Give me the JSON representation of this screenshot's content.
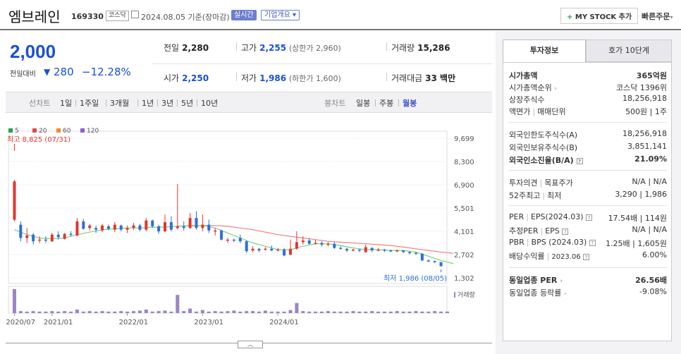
{
  "header": {
    "name": "엠브레인",
    "code": "169330",
    "market": "코스닥",
    "date": "2024.08.05 기준(장마감)",
    "realtime": "실시간",
    "overview": "기업개요",
    "mystock": "MY STOCK 추가",
    "quick_order": "빠른주문"
  },
  "price": {
    "current": "2,000",
    "change_label": "전일대비",
    "change_arrow": "▼",
    "change": "280",
    "change_pct": "−12.28%"
  },
  "quote": {
    "prev_label": "전일",
    "prev": "2,280",
    "high_label": "고가",
    "high": "2,255",
    "high_sub": "(상한가 2,960)",
    "volume_label": "거래량",
    "volume": "15,286",
    "open_label": "시가",
    "open": "2,250",
    "low_label": "저가",
    "low": "1,986",
    "low_sub": "(하한가 1,600)",
    "amount_label": "거래대금",
    "amount": "33 백만"
  },
  "tabs": {
    "line_label": "선차트",
    "periods": [
      "1일",
      "1주일",
      "3개월",
      "1년",
      "3년",
      "5년",
      "10년"
    ],
    "candle_label": "봉차트",
    "candles": [
      "일봉",
      "주봉",
      "월봉"
    ],
    "selected_candle": "월봉"
  },
  "chart_data": {
    "type": "candlestick",
    "legend": [
      "5",
      "20",
      "60",
      "120"
    ],
    "legend_colors": [
      "#2e9e4a",
      "#e5484d",
      "#f08c2e",
      "#8a62c8"
    ],
    "y_ticks": [
      "9,699",
      "8,300",
      "6,900",
      "5,501",
      "4,101",
      "2,702",
      "1,302"
    ],
    "ylim": [
      1302,
      9699
    ],
    "x_ticks": [
      "2020/07",
      "2021/01",
      "2022/01",
      "2023/01",
      "2024/01"
    ],
    "high_annotation": "최고 8,825 (07/31)",
    "low_annotation": "최저 1,986 (08/05)",
    "volume_label": "거래량",
    "candles": [
      {
        "o": 4800,
        "c": 7100,
        "h": 7200,
        "l": 4700
      },
      {
        "o": 4500,
        "c": 3700,
        "h": 4700,
        "l": 3500
      },
      {
        "o": 3700,
        "c": 3850,
        "h": 4300,
        "l": 3400
      },
      {
        "o": 3900,
        "c": 3500,
        "h": 4000,
        "l": 3300
      },
      {
        "o": 3550,
        "c": 3600,
        "h": 3800,
        "l": 3400
      },
      {
        "o": 3600,
        "c": 3550,
        "h": 3800,
        "l": 3400
      },
      {
        "o": 3500,
        "c": 3900,
        "h": 4000,
        "l": 3450
      },
      {
        "o": 3900,
        "c": 3750,
        "h": 4100,
        "l": 3600
      },
      {
        "o": 3650,
        "c": 3950,
        "h": 4000,
        "l": 3600
      },
      {
        "o": 3950,
        "c": 3900,
        "h": 4100,
        "l": 3800
      },
      {
        "o": 3850,
        "c": 4700,
        "h": 4900,
        "l": 3800
      },
      {
        "o": 4700,
        "c": 4250,
        "h": 4850,
        "l": 4200
      },
      {
        "o": 4300,
        "c": 4450,
        "h": 4550,
        "l": 4150
      },
      {
        "o": 4300,
        "c": 4200,
        "h": 4450,
        "l": 4000
      },
      {
        "o": 4150,
        "c": 4450,
        "h": 4550,
        "l": 4050
      },
      {
        "o": 4400,
        "c": 4250,
        "h": 4500,
        "l": 4150
      },
      {
        "o": 4200,
        "c": 4500,
        "h": 4650,
        "l": 4050
      },
      {
        "o": 4450,
        "c": 4200,
        "h": 4500,
        "l": 4100
      },
      {
        "o": 4200,
        "c": 4300,
        "h": 4450,
        "l": 4000
      },
      {
        "o": 4300,
        "c": 4450,
        "h": 4600,
        "l": 4200
      },
      {
        "o": 4450,
        "c": 4200,
        "h": 4550,
        "l": 4100
      },
      {
        "o": 4200,
        "c": 4750,
        "h": 4900,
        "l": 4100
      },
      {
        "o": 4750,
        "c": 4400,
        "h": 4800,
        "l": 4300
      },
      {
        "o": 4400,
        "c": 4100,
        "h": 4500,
        "l": 3950
      },
      {
        "o": 4100,
        "c": 4650,
        "h": 5100,
        "l": 4050
      },
      {
        "o": 4650,
        "c": 4200,
        "h": 5000,
        "l": 4100
      },
      {
        "o": 4300,
        "c": 4400,
        "h": 6950,
        "l": 4200
      },
      {
        "o": 4400,
        "c": 4300,
        "h": 4700,
        "l": 4150
      },
      {
        "o": 4300,
        "c": 4900,
        "h": 5200,
        "l": 4250
      },
      {
        "o": 4900,
        "c": 4300,
        "h": 5300,
        "l": 4200
      },
      {
        "o": 4300,
        "c": 4500,
        "h": 5100,
        "l": 4100
      },
      {
        "o": 4500,
        "c": 4150,
        "h": 4800,
        "l": 4000
      },
      {
        "o": 4150,
        "c": 4150,
        "h": 4300,
        "l": 3850
      },
      {
        "o": 4150,
        "c": 3600,
        "h": 4200,
        "l": 3550
      },
      {
        "o": 3600,
        "c": 3600,
        "h": 3700,
        "l": 3400
      },
      {
        "o": 3600,
        "c": 3550,
        "h": 3650,
        "l": 3450
      },
      {
        "o": 3700,
        "c": 3500,
        "h": 3900,
        "l": 3400
      },
      {
        "o": 3500,
        "c": 2900,
        "h": 3550,
        "l": 2800
      },
      {
        "o": 2950,
        "c": 3050,
        "h": 3200,
        "l": 2850
      },
      {
        "o": 3050,
        "c": 2950,
        "h": 3100,
        "l": 2850
      },
      {
        "o": 3000,
        "c": 3050,
        "h": 3150,
        "l": 2950
      },
      {
        "o": 3050,
        "c": 2950,
        "h": 3250,
        "l": 2900
      },
      {
        "o": 2950,
        "c": 3000,
        "h": 3100,
        "l": 2900
      },
      {
        "o": 3000,
        "c": 2650,
        "h": 3100,
        "l": 2600
      },
      {
        "o": 2700,
        "c": 3050,
        "h": 3600,
        "l": 2650
      },
      {
        "o": 3050,
        "c": 3450,
        "h": 4100,
        "l": 3000
      },
      {
        "o": 3450,
        "c": 3550,
        "h": 3800,
        "l": 3300
      },
      {
        "o": 3550,
        "c": 3350,
        "h": 3700,
        "l": 3300
      },
      {
        "o": 3350,
        "c": 3400,
        "h": 3600,
        "l": 3300
      },
      {
        "o": 3400,
        "c": 3300,
        "h": 3500,
        "l": 3200
      },
      {
        "o": 3300,
        "c": 3350,
        "h": 3450,
        "l": 3200
      },
      {
        "o": 3350,
        "c": 3100,
        "h": 3450,
        "l": 3050
      },
      {
        "o": 3100,
        "c": 3050,
        "h": 3200,
        "l": 3000
      },
      {
        "o": 3050,
        "c": 2950,
        "h": 3100,
        "l": 2850
      },
      {
        "o": 2950,
        "c": 3000,
        "h": 3050,
        "l": 2900
      },
      {
        "o": 3000,
        "c": 2950,
        "h": 3050,
        "l": 2850
      },
      {
        "o": 2850,
        "c": 3150,
        "h": 3300,
        "l": 2800
      },
      {
        "o": 3100,
        "c": 2950,
        "h": 3150,
        "l": 2850
      },
      {
        "o": 2950,
        "c": 3000,
        "h": 3100,
        "l": 2900
      },
      {
        "o": 3000,
        "c": 2950,
        "h": 3050,
        "l": 2850
      },
      {
        "o": 2950,
        "c": 2900,
        "h": 3000,
        "l": 2850
      },
      {
        "o": 2900,
        "c": 2950,
        "h": 3000,
        "l": 2850
      },
      {
        "o": 2950,
        "c": 2850,
        "h": 2950,
        "l": 2800
      },
      {
        "o": 2850,
        "c": 2800,
        "h": 2900,
        "l": 2700
      },
      {
        "o": 2800,
        "c": 2750,
        "h": 2850,
        "l": 2700
      },
      {
        "o": 2750,
        "c": 2350,
        "h": 2800,
        "l": 2300
      },
      {
        "o": 2350,
        "c": 2300,
        "h": 2400,
        "l": 2250
      },
      {
        "o": 2300,
        "c": 2250,
        "h": 2350,
        "l": 2200
      },
      {
        "o": 2250,
        "c": 2000,
        "h": 2255,
        "l": 1986
      }
    ],
    "ma20": [
      null,
      null,
      null,
      null,
      null,
      null,
      null,
      null,
      null,
      null,
      null,
      null,
      null,
      null,
      null,
      null,
      null,
      null,
      null,
      null,
      null,
      null,
      null,
      null,
      null,
      null,
      null,
      null,
      null,
      null,
      null,
      null,
      null,
      null,
      null,
      null,
      null,
      null,
      null,
      null,
      null,
      null,
      null,
      null,
      null,
      null,
      null,
      null,
      null,
      null,
      null,
      null,
      null,
      null,
      null,
      null,
      null,
      null,
      null,
      null,
      null,
      null,
      null,
      null,
      null,
      null,
      null,
      null,
      null,
      null
    ],
    "ma20_line": [
      [
        26,
        4420
      ],
      [
        28,
        4420
      ],
      [
        30,
        4440
      ],
      [
        32,
        4450
      ],
      [
        34,
        4400
      ],
      [
        36,
        4300
      ],
      [
        38,
        4200
      ],
      [
        40,
        4050
      ],
      [
        42,
        3900
      ],
      [
        44,
        3800
      ],
      [
        46,
        3700
      ],
      [
        48,
        3600
      ],
      [
        50,
        3500
      ],
      [
        52,
        3450
      ],
      [
        54,
        3400
      ],
      [
        56,
        3350
      ],
      [
        58,
        3300
      ],
      [
        60,
        3250
      ],
      [
        62,
        3150
      ],
      [
        64,
        3050
      ],
      [
        66,
        2950
      ],
      [
        68,
        2850
      ],
      [
        70,
        2780
      ]
    ],
    "ma5_line": [
      [
        0,
        4200
      ],
      [
        2,
        3900
      ],
      [
        4,
        3700
      ],
      [
        6,
        3650
      ],
      [
        8,
        3700
      ],
      [
        10,
        3900
      ],
      [
        12,
        4050
      ],
      [
        14,
        4200
      ],
      [
        16,
        4250
      ],
      [
        18,
        4300
      ],
      [
        20,
        4300
      ],
      [
        22,
        4350
      ],
      [
        24,
        4350
      ],
      [
        26,
        4400
      ],
      [
        28,
        4450
      ],
      [
        30,
        4450
      ],
      [
        32,
        4300
      ],
      [
        34,
        4000
      ],
      [
        36,
        3700
      ],
      [
        38,
        3400
      ],
      [
        40,
        3200
      ],
      [
        42,
        3000
      ],
      [
        44,
        3000
      ],
      [
        46,
        3200
      ],
      [
        48,
        3350
      ],
      [
        50,
        3350
      ],
      [
        52,
        3250
      ],
      [
        54,
        3100
      ],
      [
        56,
        3000
      ],
      [
        58,
        3000
      ],
      [
        60,
        2950
      ],
      [
        62,
        2950
      ],
      [
        64,
        2850
      ],
      [
        66,
        2600
      ],
      [
        68,
        2350
      ],
      [
        70,
        2150
      ]
    ],
    "volumes": [
      95,
      8,
      6,
      8,
      6,
      6,
      8,
      6,
      8,
      6,
      14,
      6,
      8,
      6,
      8,
      6,
      6,
      8,
      6,
      8,
      10,
      14,
      6,
      8,
      10,
      6,
      72,
      8,
      18,
      6,
      12,
      6,
      8,
      6,
      8,
      10,
      6,
      8,
      8,
      6,
      10,
      6,
      6,
      6,
      12,
      40,
      8,
      6,
      6,
      6,
      8,
      6,
      6,
      6,
      8,
      6,
      6,
      8,
      6,
      6,
      6,
      8,
      6,
      6,
      8,
      6,
      6,
      8,
      6,
      6
    ]
  },
  "invest_tabs": {
    "active": "투자정보",
    "other": "호가 10단계"
  },
  "invest": {
    "market_cap_label": "시가총액",
    "market_cap": "365억원",
    "rank_label": "시가총액순위",
    "rank": "코스닥 1396위",
    "shares_label": "상장주식수",
    "shares": "18,256,918",
    "face_label": "액면가",
    "unit_label": "매매단위",
    "face_unit": "500원 | 1주",
    "foreign_limit_label": "외국인한도주식수(A)",
    "foreign_limit": "18,256,918",
    "foreign_hold_label": "외국인보유주식수(B)",
    "foreign_hold": "3,851,141",
    "foreign_ratio_label": "외국인소진율(B/A)",
    "foreign_ratio": "21.09%",
    "opinion_label": "투자의견",
    "target_label": "목표주가",
    "opinion": "N/A | N/A",
    "w52_label": "52주최고",
    "w52_low_label": "최저",
    "w52": "3,290 | 1,986",
    "per_label": "PER",
    "eps_label": "EPS(2024.03)",
    "per": "17.54배 | 114원",
    "fper_label": "추정PER",
    "feps_label": "EPS",
    "fper": "N/A | N/A",
    "pbr_label": "PBR",
    "bps_label": "BPS (2024.03)",
    "pbr": "1.25배 | 1,605원",
    "div_label": "배당수익률",
    "div_date": "2023.06",
    "div": "6.00%",
    "sector_per_label": "동일업종 PER",
    "sector_per": "26.56배",
    "sector_chg_label": "동일업종 등락률",
    "sector_chg": "-9.08%"
  }
}
